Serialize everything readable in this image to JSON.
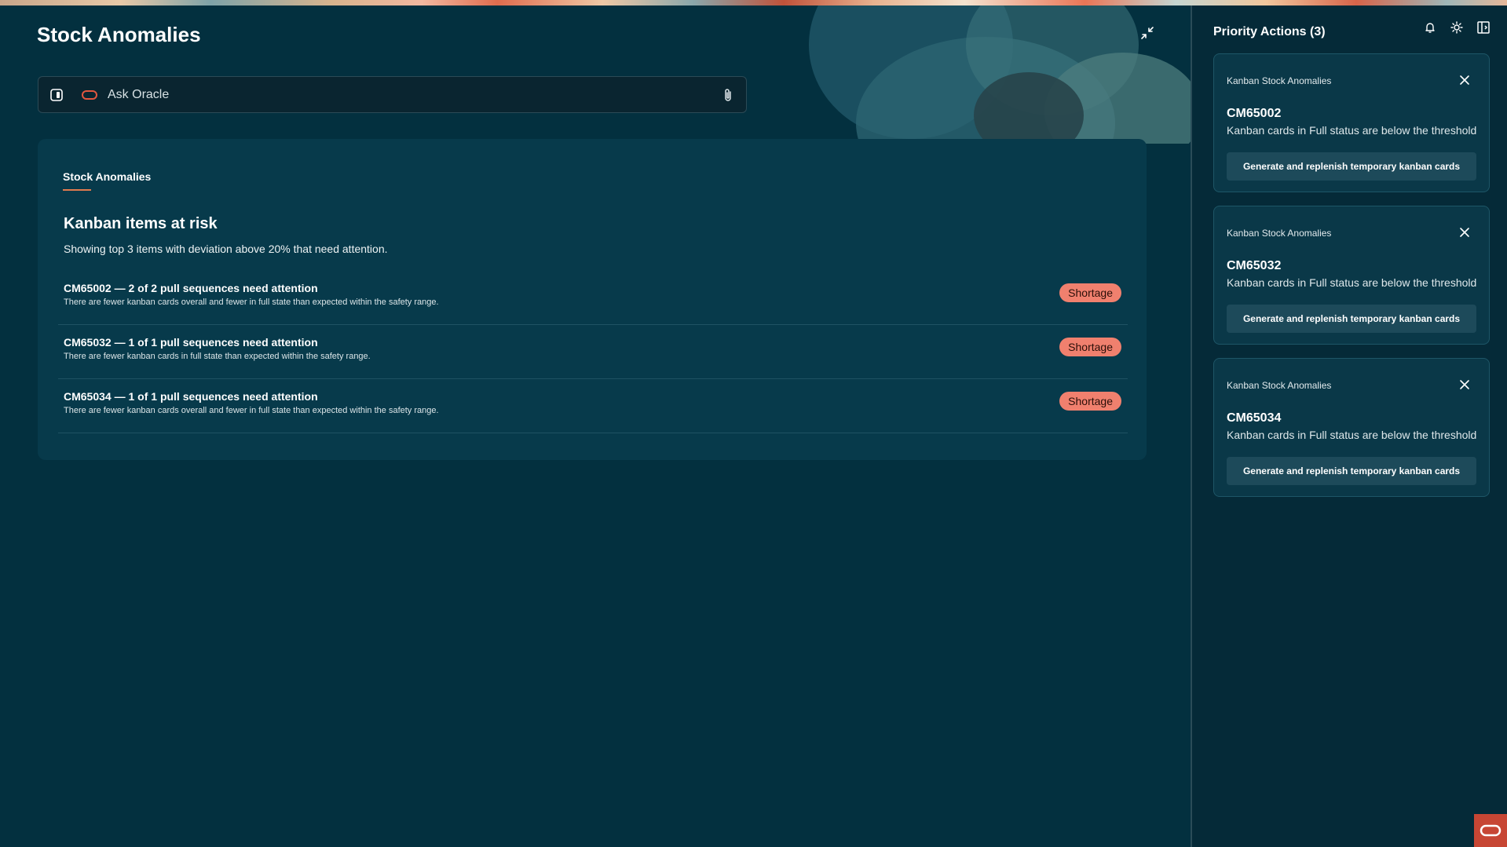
{
  "header": {
    "title": "Stock Anomalies"
  },
  "ask": {
    "placeholder": "Ask Oracle"
  },
  "card": {
    "section_label": "Stock Anomalies",
    "title": "Kanban items at risk",
    "description": "Showing top 3 items with deviation above 20% that need attention.",
    "rows": [
      {
        "title": "CM65002 — 2 of 2 pull sequences need attention",
        "description": "There are fewer kanban cards overall and fewer in full state than expected within the safety range.",
        "badge": "Shortage"
      },
      {
        "title": "CM65032 — 1 of 1 pull sequences need attention",
        "description": "There are fewer kanban cards in full state than expected within the safety range.",
        "badge": "Shortage"
      },
      {
        "title": "CM65034 — 1 of 1 pull sequences need attention",
        "description": "There are fewer kanban cards overall and fewer in full state than expected within the safety range.",
        "badge": "Shortage"
      }
    ]
  },
  "side": {
    "title": "Priority Actions (3)",
    "actions": [
      {
        "category": "Kanban Stock Anomalies",
        "id": "CM65002",
        "description": "Kanban cards in Full status are below the threshold",
        "button": "Generate and replenish temporary kanban cards"
      },
      {
        "category": "Kanban Stock Anomalies",
        "id": "CM65032",
        "description": "Kanban cards in Full status are below the threshold",
        "button": "Generate and replenish temporary kanban cards"
      },
      {
        "category": "Kanban Stock Anomalies",
        "id": "CM65034",
        "description": "Kanban cards in Full status are below the threshold",
        "button": "Generate and replenish temporary kanban cards"
      }
    ]
  },
  "colors": {
    "background": "#03303f",
    "card": "#073a4b",
    "badge": "#f0806e",
    "accent": "#c74634"
  },
  "icons": {
    "minimize": "collapse-arrows-icon",
    "sidebar_toggle": "sidebar-toggle-icon",
    "oracle": "oracle-logo-icon",
    "attach": "paperclip-icon",
    "bell": "bell-icon",
    "theme": "sun-icon",
    "panel": "panel-toggle-icon",
    "close": "close-icon"
  }
}
